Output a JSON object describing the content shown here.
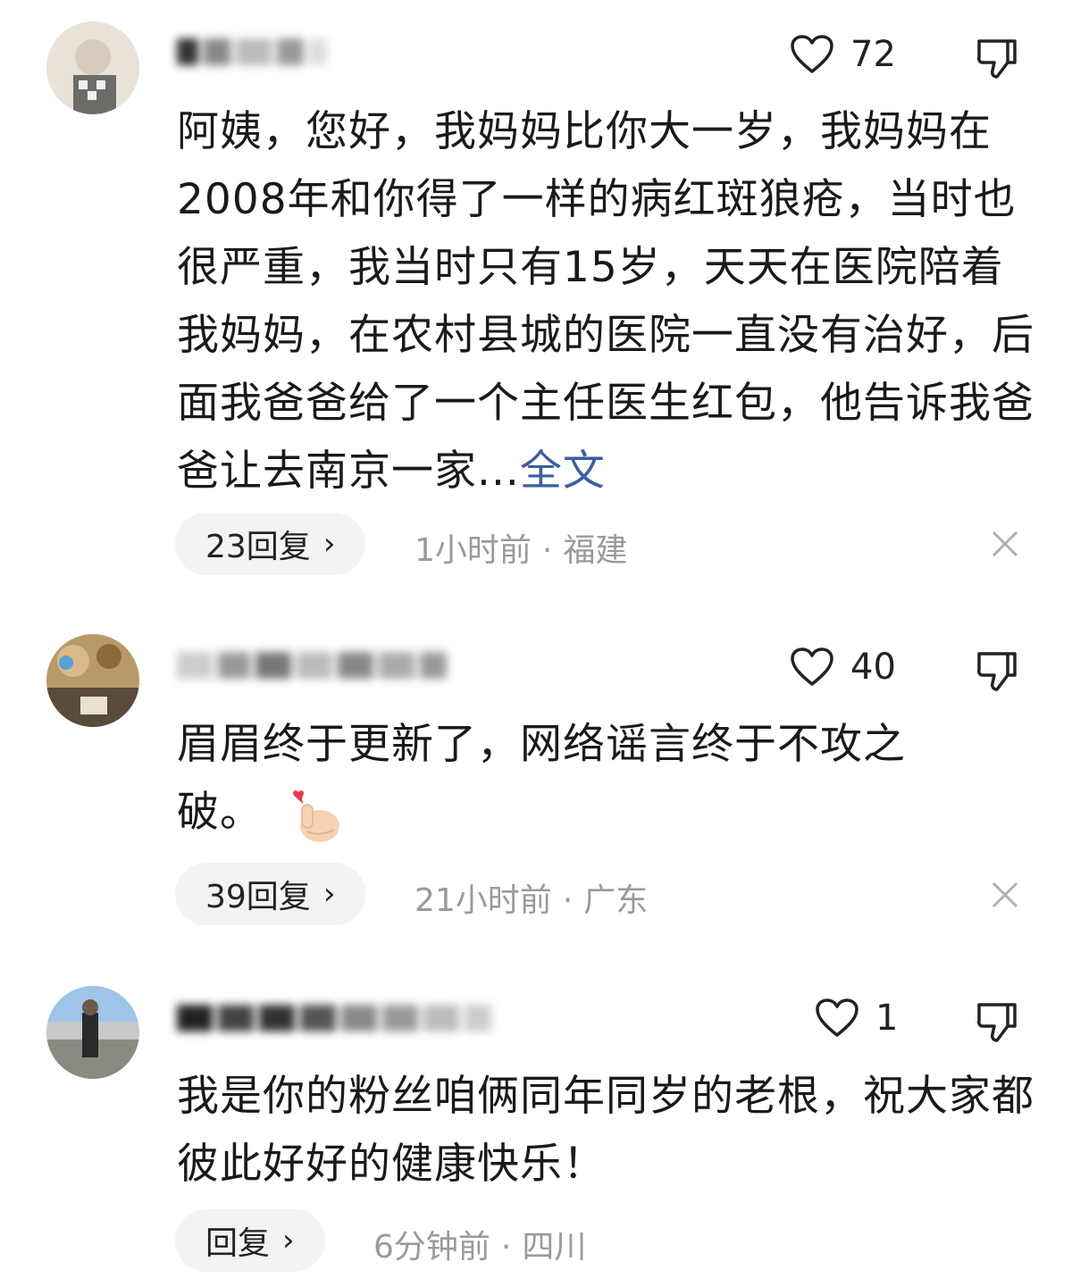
{
  "comments": [
    {
      "likes": "72",
      "text": "阿姨，您好，我妈妈比你大一岁，我妈妈在2008年和你得了一样的病红斑狼疮，当时也很严重，我当时只有15岁，天天在医院陪着我妈妈，在农村县城的医院一直没有治好，后面我爸爸给了一个主任医生红包，他告诉我爸爸让去南京一家...",
      "more_link": "全文",
      "reply_label": "23回复",
      "time": "1小时前",
      "location": "福建"
    },
    {
      "likes": "40",
      "text": "眉眉终于更新了，网络谣言终于不攻之破。",
      "emoji": "heart-hands-emoji",
      "reply_label": "39回复",
      "time": "21小时前",
      "location": "广东"
    },
    {
      "likes": "1",
      "text": "我是你的粉丝咱俩同年同岁的老根，祝大家都彼此好好的健康快乐！",
      "reply_label": "回复",
      "time": "6分钟前",
      "location": "四川"
    }
  ],
  "separator": "·",
  "reply_chevron": "›"
}
